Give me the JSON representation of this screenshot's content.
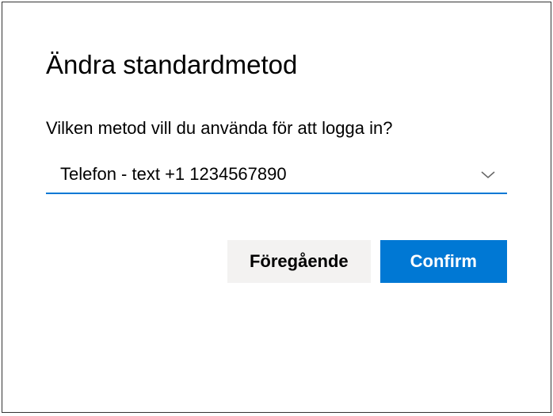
{
  "dialog": {
    "title": "Ändra standardmetod",
    "prompt": "Vilken metod vill du använda för att logga in?",
    "dropdown": {
      "selected": "Telefon - text +1 1234567890"
    },
    "buttons": {
      "back": "Föregående",
      "confirm": "Confirm"
    }
  }
}
